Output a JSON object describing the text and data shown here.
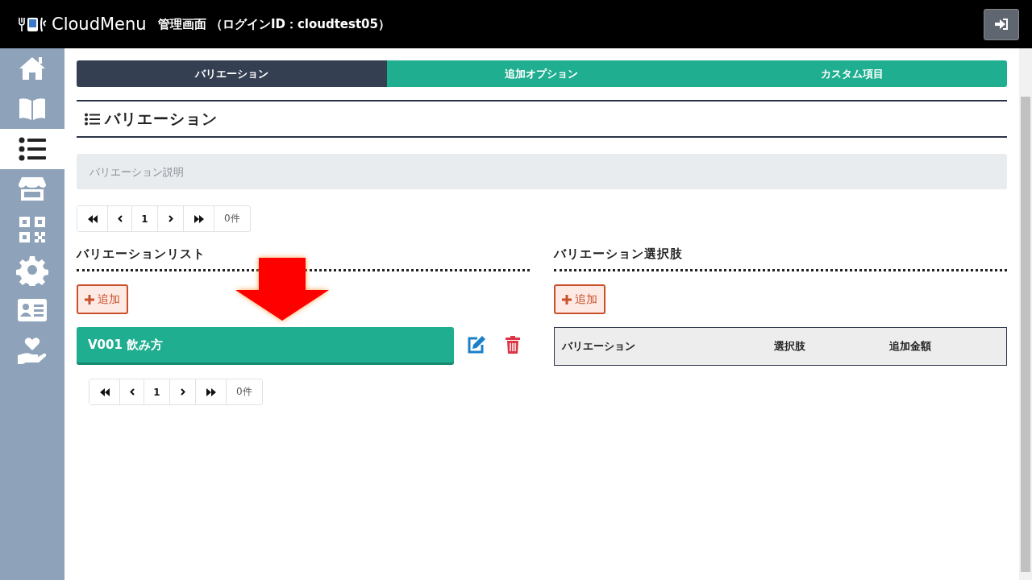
{
  "header": {
    "logo": "CloudMenu",
    "title": "管理画面 （ログインID：cloudtest05）"
  },
  "sidebar": {
    "items": [
      {
        "kind": "home",
        "selected": false
      },
      {
        "kind": "book",
        "selected": false
      },
      {
        "kind": "list",
        "selected": true
      },
      {
        "kind": "store",
        "selected": false
      },
      {
        "kind": "qr",
        "selected": false
      },
      {
        "kind": "gear",
        "selected": false
      },
      {
        "kind": "card",
        "selected": false
      },
      {
        "kind": "care",
        "selected": false
      }
    ]
  },
  "tabs": [
    {
      "label": "バリエーション",
      "selected": true
    },
    {
      "label": "追加オプション",
      "selected": false
    },
    {
      "label": "カスタム項目",
      "selected": false
    }
  ],
  "heading": "バリエーション",
  "description": {
    "placeholder": "バリエーション説明"
  },
  "pager_top": {
    "page": "1",
    "count": "0件"
  },
  "variation_list": {
    "title": "バリエーションリスト",
    "add_button": "追加",
    "items": [
      {
        "label": "V001 飲み方"
      }
    ],
    "pager": {
      "page": "1",
      "count": "0件"
    }
  },
  "choices": {
    "title": "バリエーション選択肢",
    "add_button": "追加",
    "table": {
      "columns": [
        "バリエーション",
        "選択肢",
        "追加金額"
      ]
    }
  }
}
